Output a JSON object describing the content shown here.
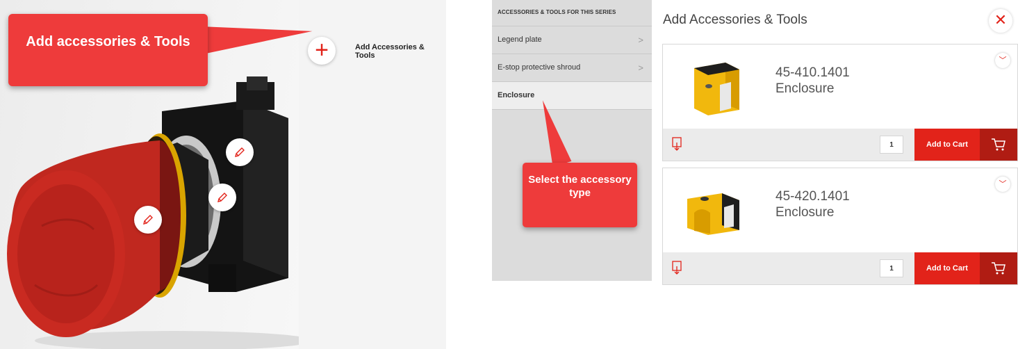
{
  "left": {
    "callout_text": "Add accessories & Tools",
    "add_link": "Add Accessories & Tools"
  },
  "middle": {
    "header": "ACCESSORIES & TOOLS FOR THIS SERIES",
    "items": [
      {
        "label": "Legend plate"
      },
      {
        "label": "E-stop protective shroud"
      },
      {
        "label": "Enclosure"
      }
    ],
    "callout_text": "Select the accessory type"
  },
  "right": {
    "title": "Add Accessories & Tools",
    "products": [
      {
        "code": "45-410.1401",
        "name": "Enclosure",
        "qty": "1",
        "add_label": "Add to Cart"
      },
      {
        "code": "45-420.1401",
        "name": "Enclosure",
        "qty": "1",
        "add_label": "Add to Cart"
      }
    ]
  },
  "colors": {
    "accent": "#e2231a",
    "callout": "#ee3b3b",
    "cart_dark": "#b01c13"
  }
}
